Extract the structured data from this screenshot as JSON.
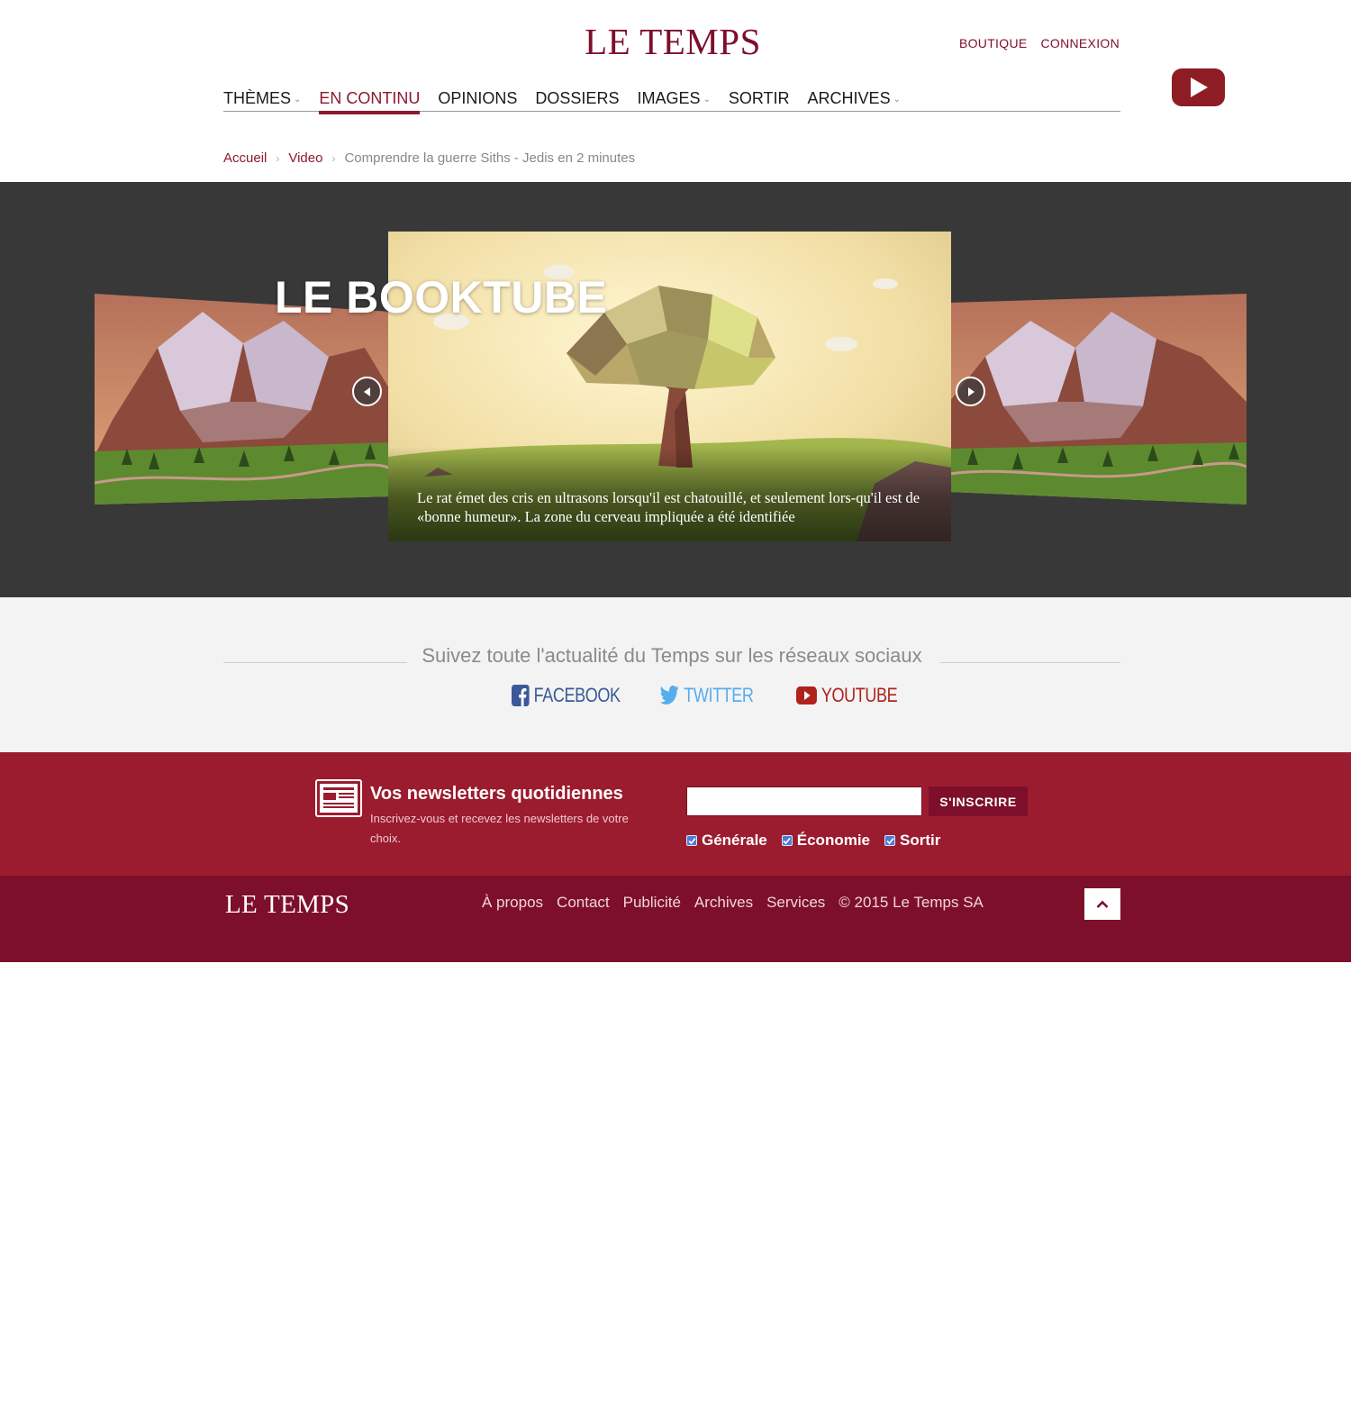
{
  "header": {
    "logo": "LE TEMPS",
    "top_links": [
      "BOUTIQUE",
      "CONNEXION"
    ],
    "nav": [
      {
        "label": "THÈMES",
        "dropdown": true
      },
      {
        "label": "EN CONTINU",
        "dropdown": false,
        "active": true
      },
      {
        "label": "OPINIONS",
        "dropdown": false
      },
      {
        "label": "DOSSIERS",
        "dropdown": false
      },
      {
        "label": "IMAGES",
        "dropdown": true
      },
      {
        "label": "SORTIR",
        "dropdown": false
      },
      {
        "label": "ARCHIVES",
        "dropdown": true
      }
    ],
    "youtube_icon": "youtube-play-icon"
  },
  "breadcrumb": {
    "home": "Accueil",
    "section": "Video",
    "current": "Comprendre la guerre Siths - Jedis en 2 minutes"
  },
  "carousel": {
    "title": "LE BOOKTUBE",
    "caption": "Le rat émet des cris en ultrasons lorsqu'il est chatouillé, et seulement lors-qu'il est de «bonne humeur». La zone du cerveau impliquée a été identifiée",
    "prev_icon": "chevron-left-icon",
    "next_icon": "chevron-right-icon"
  },
  "social": {
    "heading": "Suivez toute l'actualité du Temps sur les réseaux sociaux",
    "links": {
      "facebook": "FACEBOOK",
      "twitter": "TWITTER",
      "youtube": "YOUTUBE"
    }
  },
  "newsletter": {
    "title": "Vos newsletters quotidiennes",
    "description": "Inscrivez-vous et recevez les newsletters de votre choix.",
    "email_value": "",
    "button": "S'INSCRIRE",
    "options": [
      "Générale",
      "Économie",
      "Sortir"
    ]
  },
  "footer": {
    "logo": "LE TEMPS",
    "links": [
      "À propos",
      "Contact",
      "Publicité",
      "Archives",
      "Services"
    ],
    "copyright": "© 2015 Le Temps SA",
    "to_top_icon": "chevron-up-icon"
  },
  "colors": {
    "brand": "#7d0f2a",
    "newsletter_bg": "#9b1c2e",
    "carousel_bg": "#383838",
    "social_bg": "#f3f3f3"
  }
}
